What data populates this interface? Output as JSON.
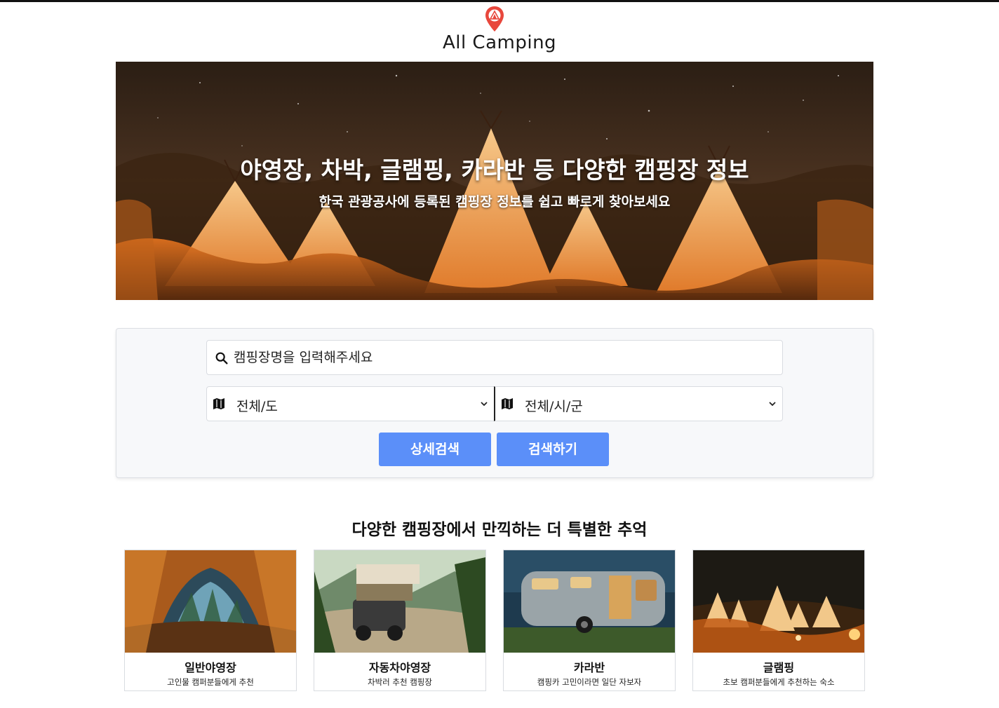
{
  "brand": {
    "name": "All Camping",
    "accent": "#e8473c"
  },
  "hero": {
    "title": "야영장, 차박, 글램핑, 카라반 등 다양한 캠핑장 정보",
    "subtitle": "한국 관광공사에 등록된 캠핑장 정보를 쉽고 빠르게 찾아보세요"
  },
  "search": {
    "placeholder": "캠핑장명을 입력해주세요",
    "province": "전체/도",
    "city": "전체/시/군",
    "detail_label": "상세검색",
    "submit_label": "검색하기",
    "button_color": "#5b8ff9"
  },
  "section": {
    "title": "다양한 캠핑장에서 만끽하는 더 특별한 추억",
    "cards": [
      {
        "title": "일반야영장",
        "desc": "고인물 캠퍼분들에게 추천"
      },
      {
        "title": "자동차야영장",
        "desc": "차박러 추천 캠핑장"
      },
      {
        "title": "카라반",
        "desc": "캠핑카 고민이라면 일단 자보자"
      },
      {
        "title": "글램핑",
        "desc": "초보 캠퍼분들에게 추천하는 숙소"
      }
    ]
  }
}
